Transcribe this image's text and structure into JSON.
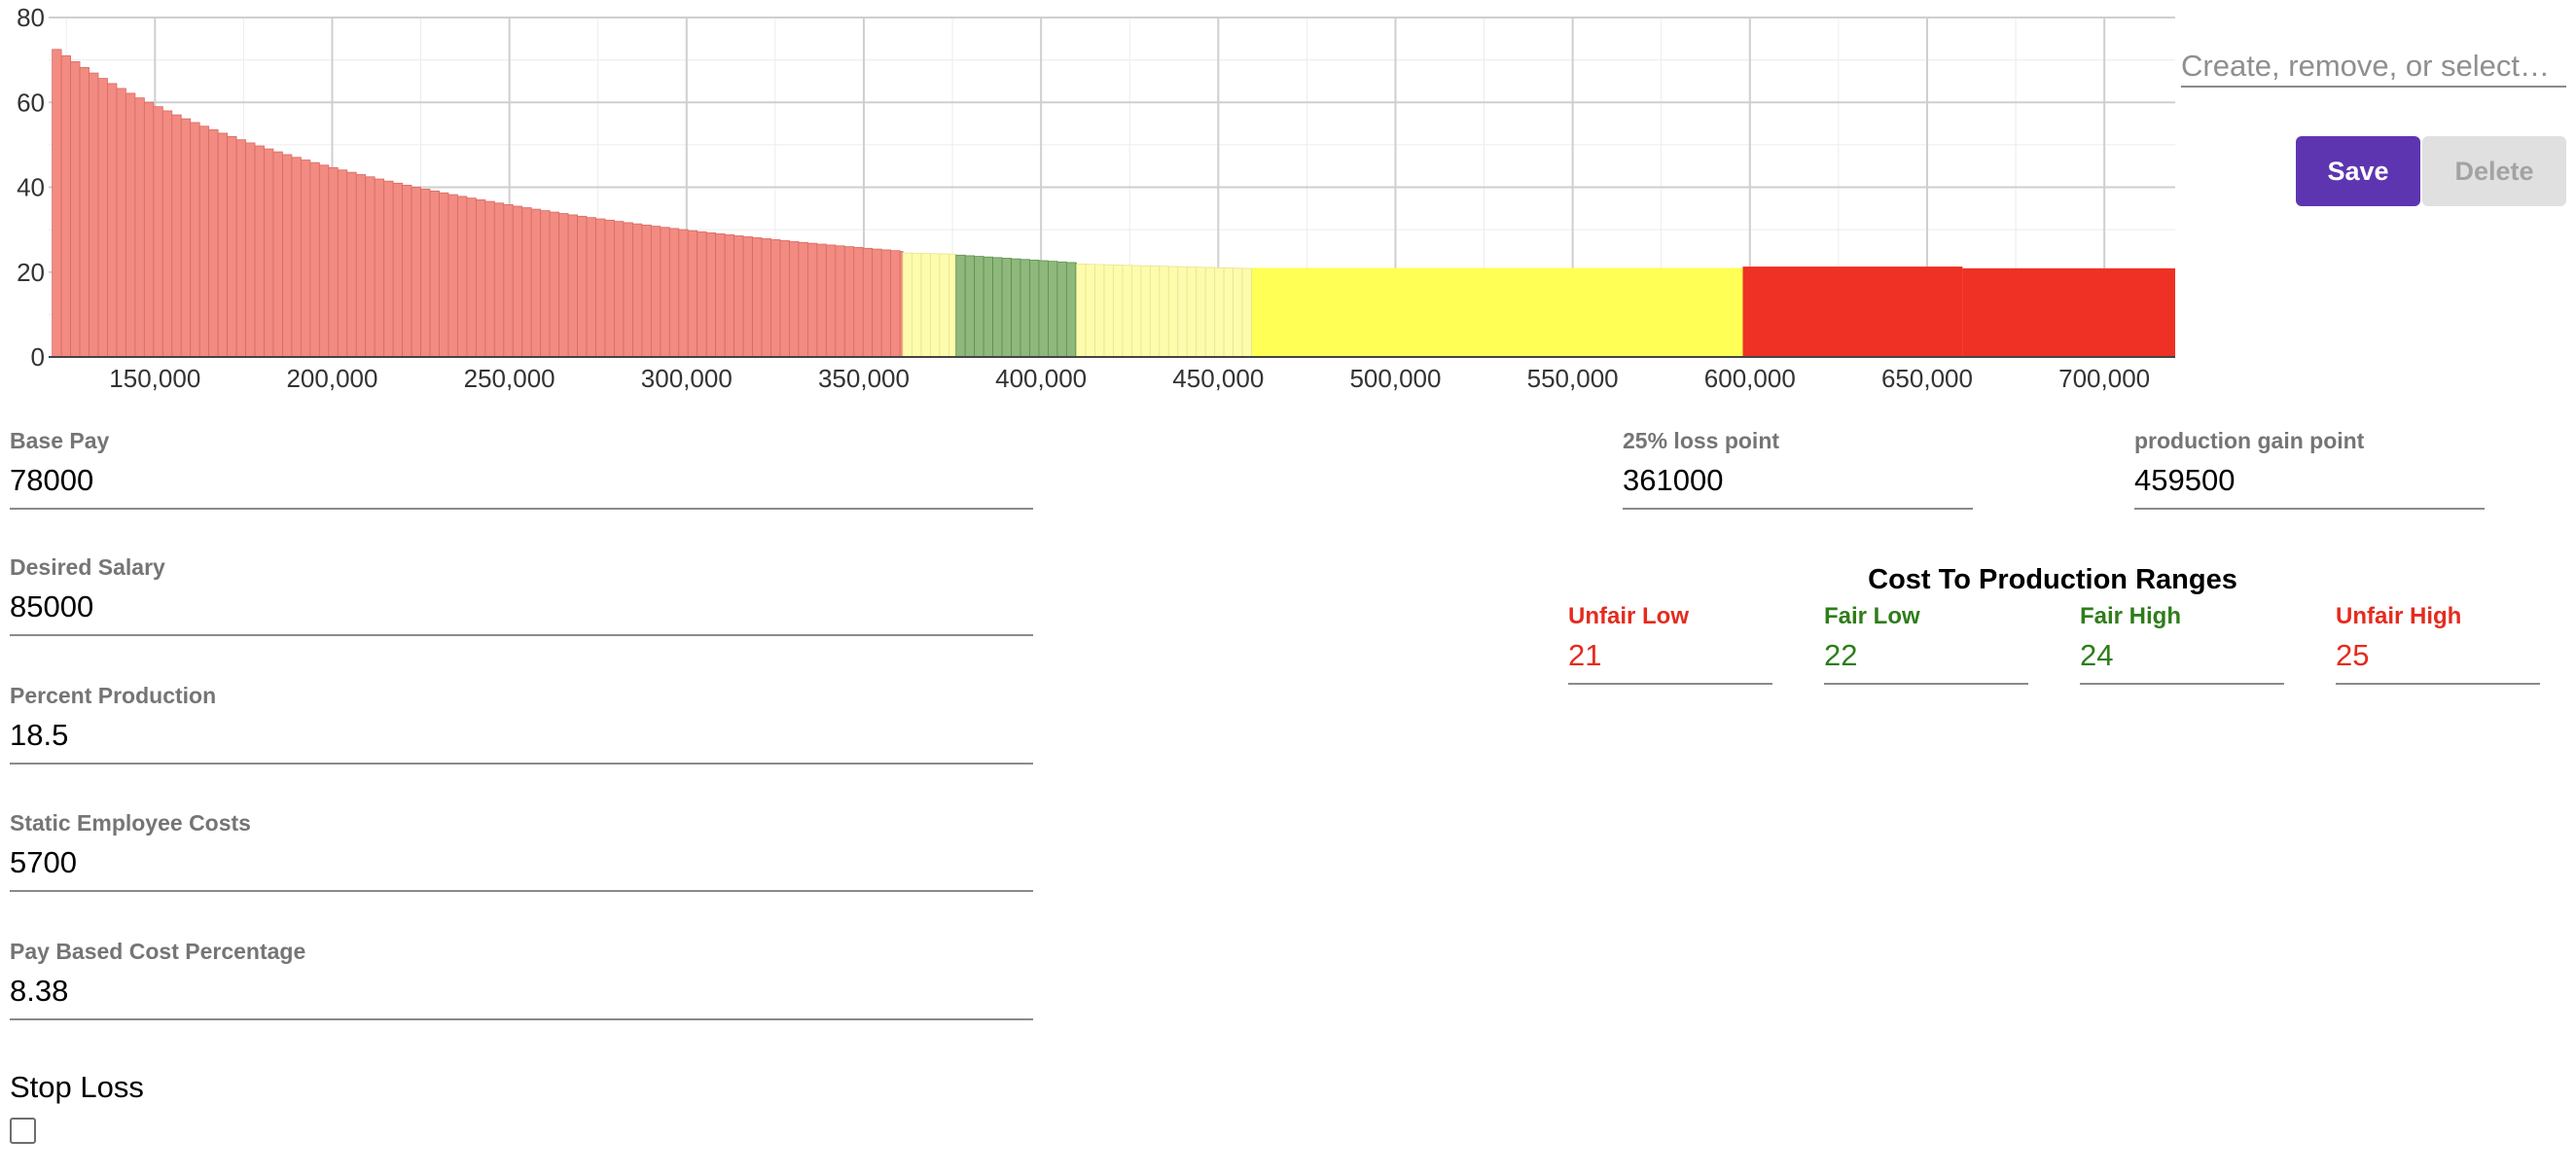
{
  "chart_data": {
    "type": "bar",
    "x_range": [
      120000,
      720000
    ],
    "ylim": [
      0,
      80
    ],
    "y_ticks": [
      "0",
      "20",
      "40",
      "60",
      "80"
    ],
    "x_ticks": [
      "150,000",
      "200,000",
      "250,000",
      "300,000",
      "350,000",
      "400,000",
      "450,000",
      "500,000",
      "550,000",
      "600,000",
      "650,000",
      "700,000"
    ],
    "series": [
      {
        "color_role": "unfair-low",
        "color": "#f28b82",
        "x": [
          121000,
          361000
        ],
        "values": [
          75.5,
          25.0
        ],
        "shape": "decreasing curve"
      },
      {
        "color_role": "light-yellow",
        "color": "#fdfbad",
        "x": [
          361000,
          376000
        ],
        "values": [
          24.5,
          24.2
        ]
      },
      {
        "color_role": "fair",
        "color": "#8fb87c",
        "x": [
          376000,
          410000
        ],
        "values": [
          24.0,
          22.1
        ]
      },
      {
        "color_role": "light-yellow",
        "color": "#fdfbad",
        "x": [
          410000,
          459500
        ],
        "values": [
          21.9,
          20.8
        ]
      },
      {
        "color_role": "yellow",
        "color": "#ffff55",
        "x": [
          459500,
          598000
        ],
        "values": [
          21.0,
          21.0
        ]
      },
      {
        "color_role": "red",
        "color": "#ee3124",
        "x": [
          598000,
          660000
        ],
        "values": [
          21.3,
          21.3
        ]
      },
      {
        "color_role": "red",
        "color": "#ee3124",
        "x": [
          660000,
          720000
        ],
        "values": [
          20.9,
          20.9
        ]
      }
    ],
    "grid": true
  },
  "selector": {
    "placeholder": "Create, remove, or select…"
  },
  "buttons": {
    "save": "Save",
    "delete": "Delete"
  },
  "form": {
    "base_pay": {
      "label": "Base Pay",
      "value": "78000"
    },
    "desired_salary": {
      "label": "Desired Salary",
      "value": "85000"
    },
    "percent_production": {
      "label": "Percent Production",
      "value": "18.5"
    },
    "static_costs": {
      "label": "Static Employee Costs",
      "value": "5700"
    },
    "pay_based_cost": {
      "label": "Pay Based Cost Percentage",
      "value": "8.38"
    },
    "loss_point": {
      "label": "25% loss point",
      "value": "361000"
    },
    "gain_point": {
      "label": "production gain point",
      "value": "459500"
    },
    "stop_loss": {
      "label": "Stop Loss",
      "checked": false
    }
  },
  "ranges": {
    "title": "Cost To Production Ranges",
    "unfair_low": {
      "label": "Unfair Low",
      "value": "21"
    },
    "fair_low": {
      "label": "Fair Low",
      "value": "22"
    },
    "fair_high": {
      "label": "Fair High",
      "value": "24"
    },
    "unfair_high": {
      "label": "Unfair High",
      "value": "25"
    }
  },
  "colors": {
    "accent": "#5e35b1",
    "unfair": "#e52b1e",
    "fair": "#2e7d1a"
  }
}
